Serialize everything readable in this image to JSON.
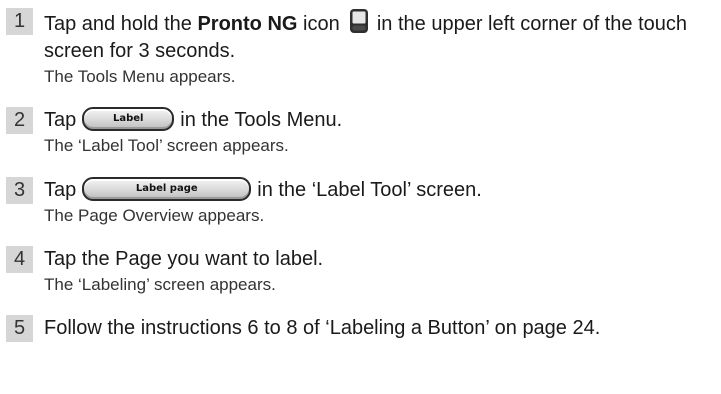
{
  "steps": [
    {
      "number": "1",
      "text_a": "Tap and hold the ",
      "text_bold": "Pronto NG",
      "text_b": " icon ",
      "icon": "pronto-device-icon",
      "text_c": " in the upper left corner of the touch screen for 3 seconds.",
      "result": "The Tools Menu appears."
    },
    {
      "number": "2",
      "text_a": "Tap",
      "button_label": "Label",
      "text_b": "in the Tools Menu.",
      "result": "The ‘Label Tool’ screen appears."
    },
    {
      "number": "3",
      "text_a": "Tap",
      "button_label": "Label page",
      "text_b": "in the ‘Label Tool’ screen.",
      "result": "The Page Overview appears."
    },
    {
      "number": "4",
      "text_a": "Tap the Page you want to label.",
      "result": "The ‘Labeling’ screen appears."
    },
    {
      "number": "5",
      "text_a": "Follow the instructions 6 to 8 of ‘Labeling a Button’ on page 24."
    }
  ]
}
